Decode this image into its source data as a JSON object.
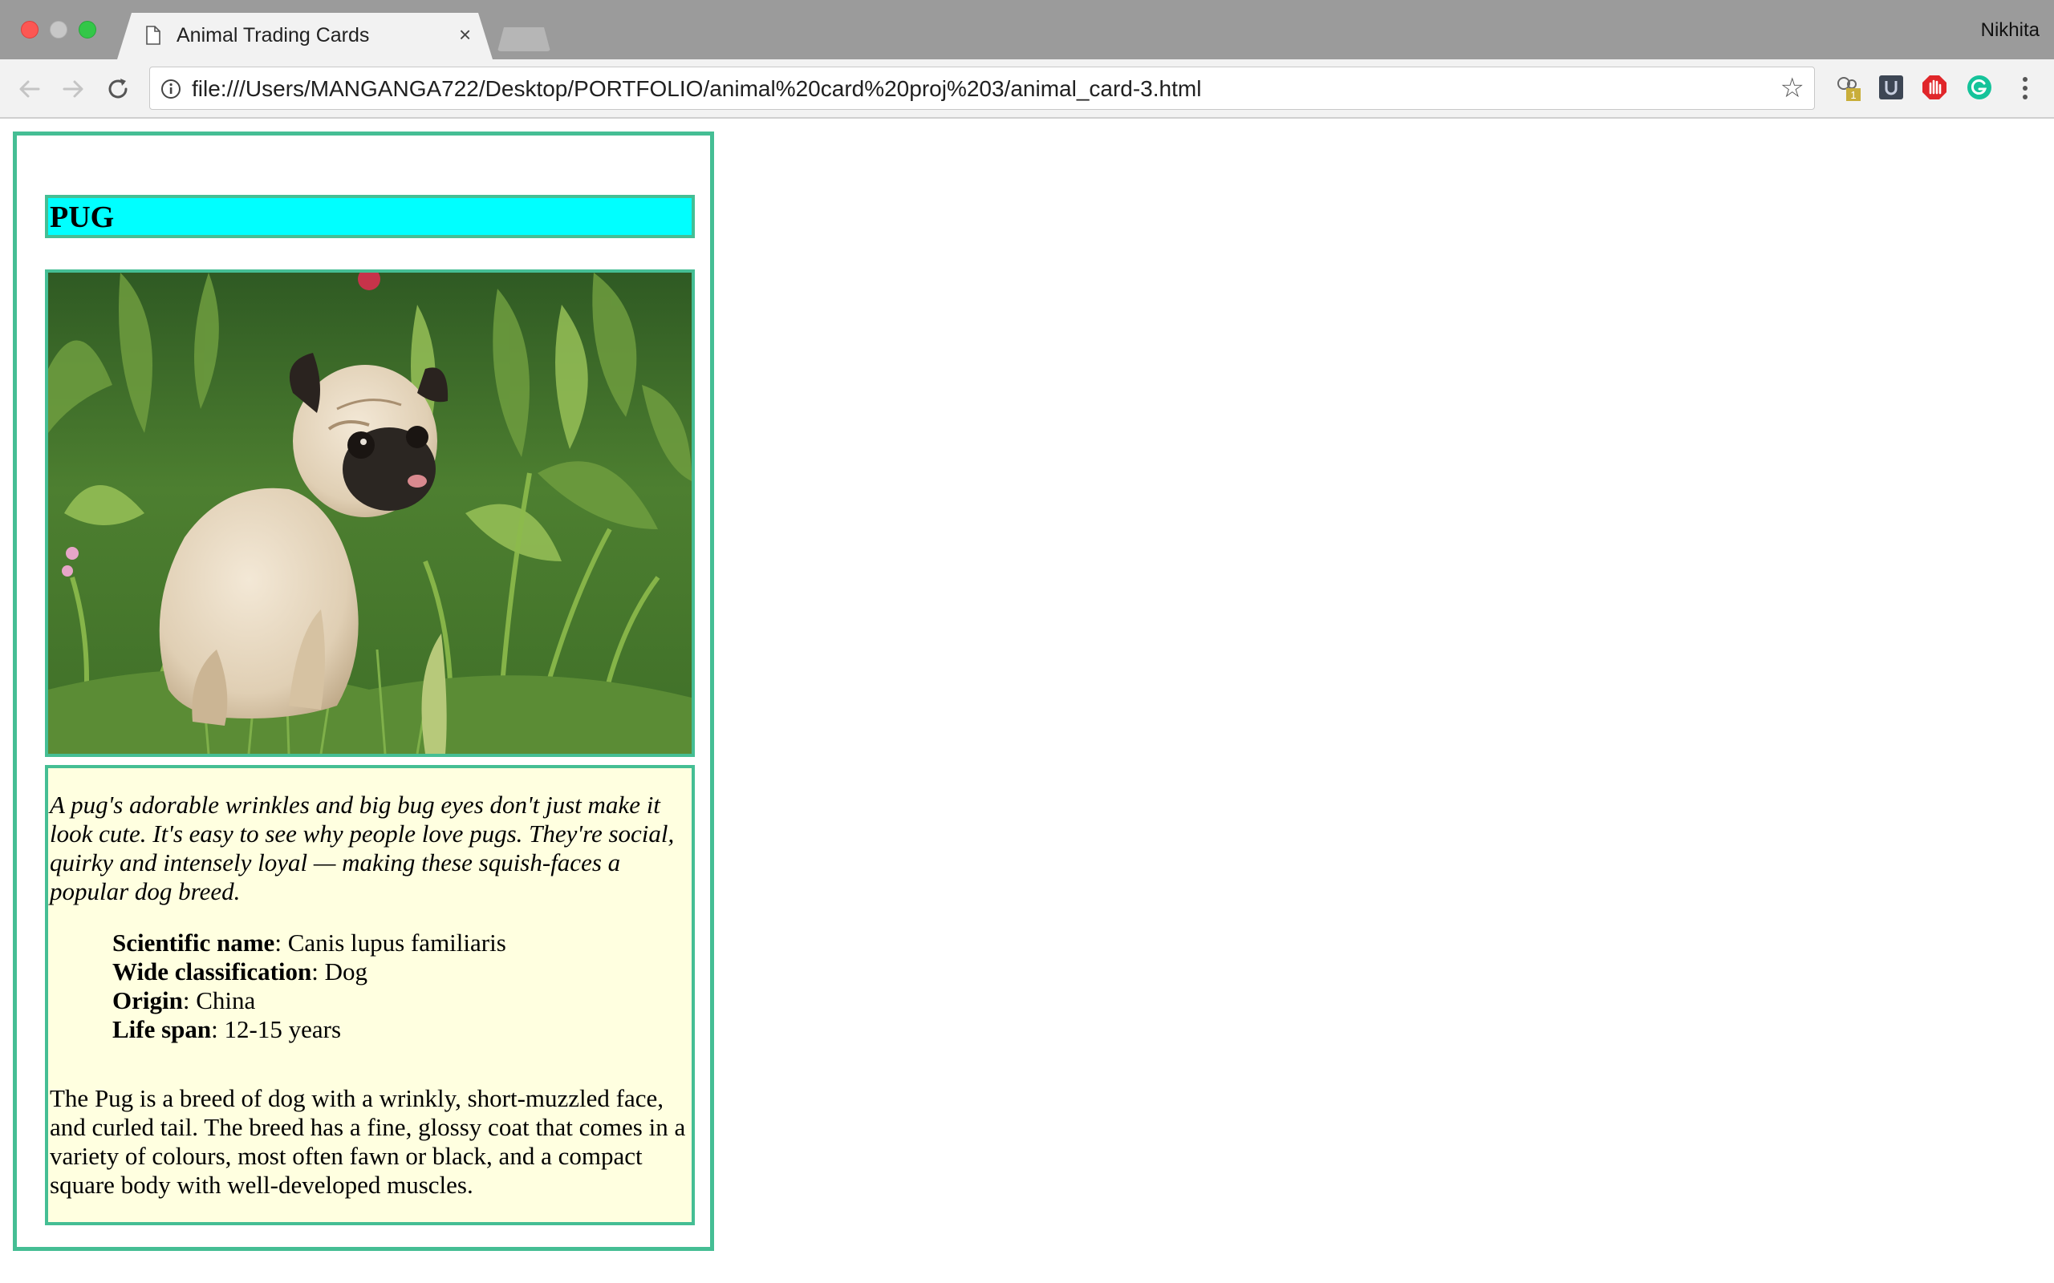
{
  "window": {
    "tab_title": "Animal Trading Cards",
    "tab_close_label": "×",
    "profile_name": "Nikhita",
    "address_url": "file:///Users/MANGANGA722/Desktop/PORTFOLIO/animal%20card%20proj%203/animal_card-3.html",
    "extension_badge": "1",
    "star_glyph": "☆"
  },
  "card": {
    "animal_name": "PUG",
    "intro": "A pug's adorable wrinkles and big bug eyes don't just make it look cute. It's easy to see why people love pugs. They're social, quirky and intensely loyal — making these squish-faces a popular dog breed.",
    "facts": [
      {
        "label": "Scientific name",
        "value": ": Canis lupus familiaris"
      },
      {
        "label": "Wide classification",
        "value": ": Dog"
      },
      {
        "label": "Origin",
        "value": ": China"
      },
      {
        "label": "Life span",
        "value": ": 12-15 years"
      }
    ],
    "description": "The Pug is a breed of dog with a wrinkly, short-muzzled face, and curled tail. The breed has a fine, glossy coat that comes in a variety of colours, most often fawn or black, and a compact square body with well-developed muscles."
  },
  "colors": {
    "card_border": "#45be94",
    "name_background": "#00ffff",
    "info_background": "#ffffe0"
  }
}
